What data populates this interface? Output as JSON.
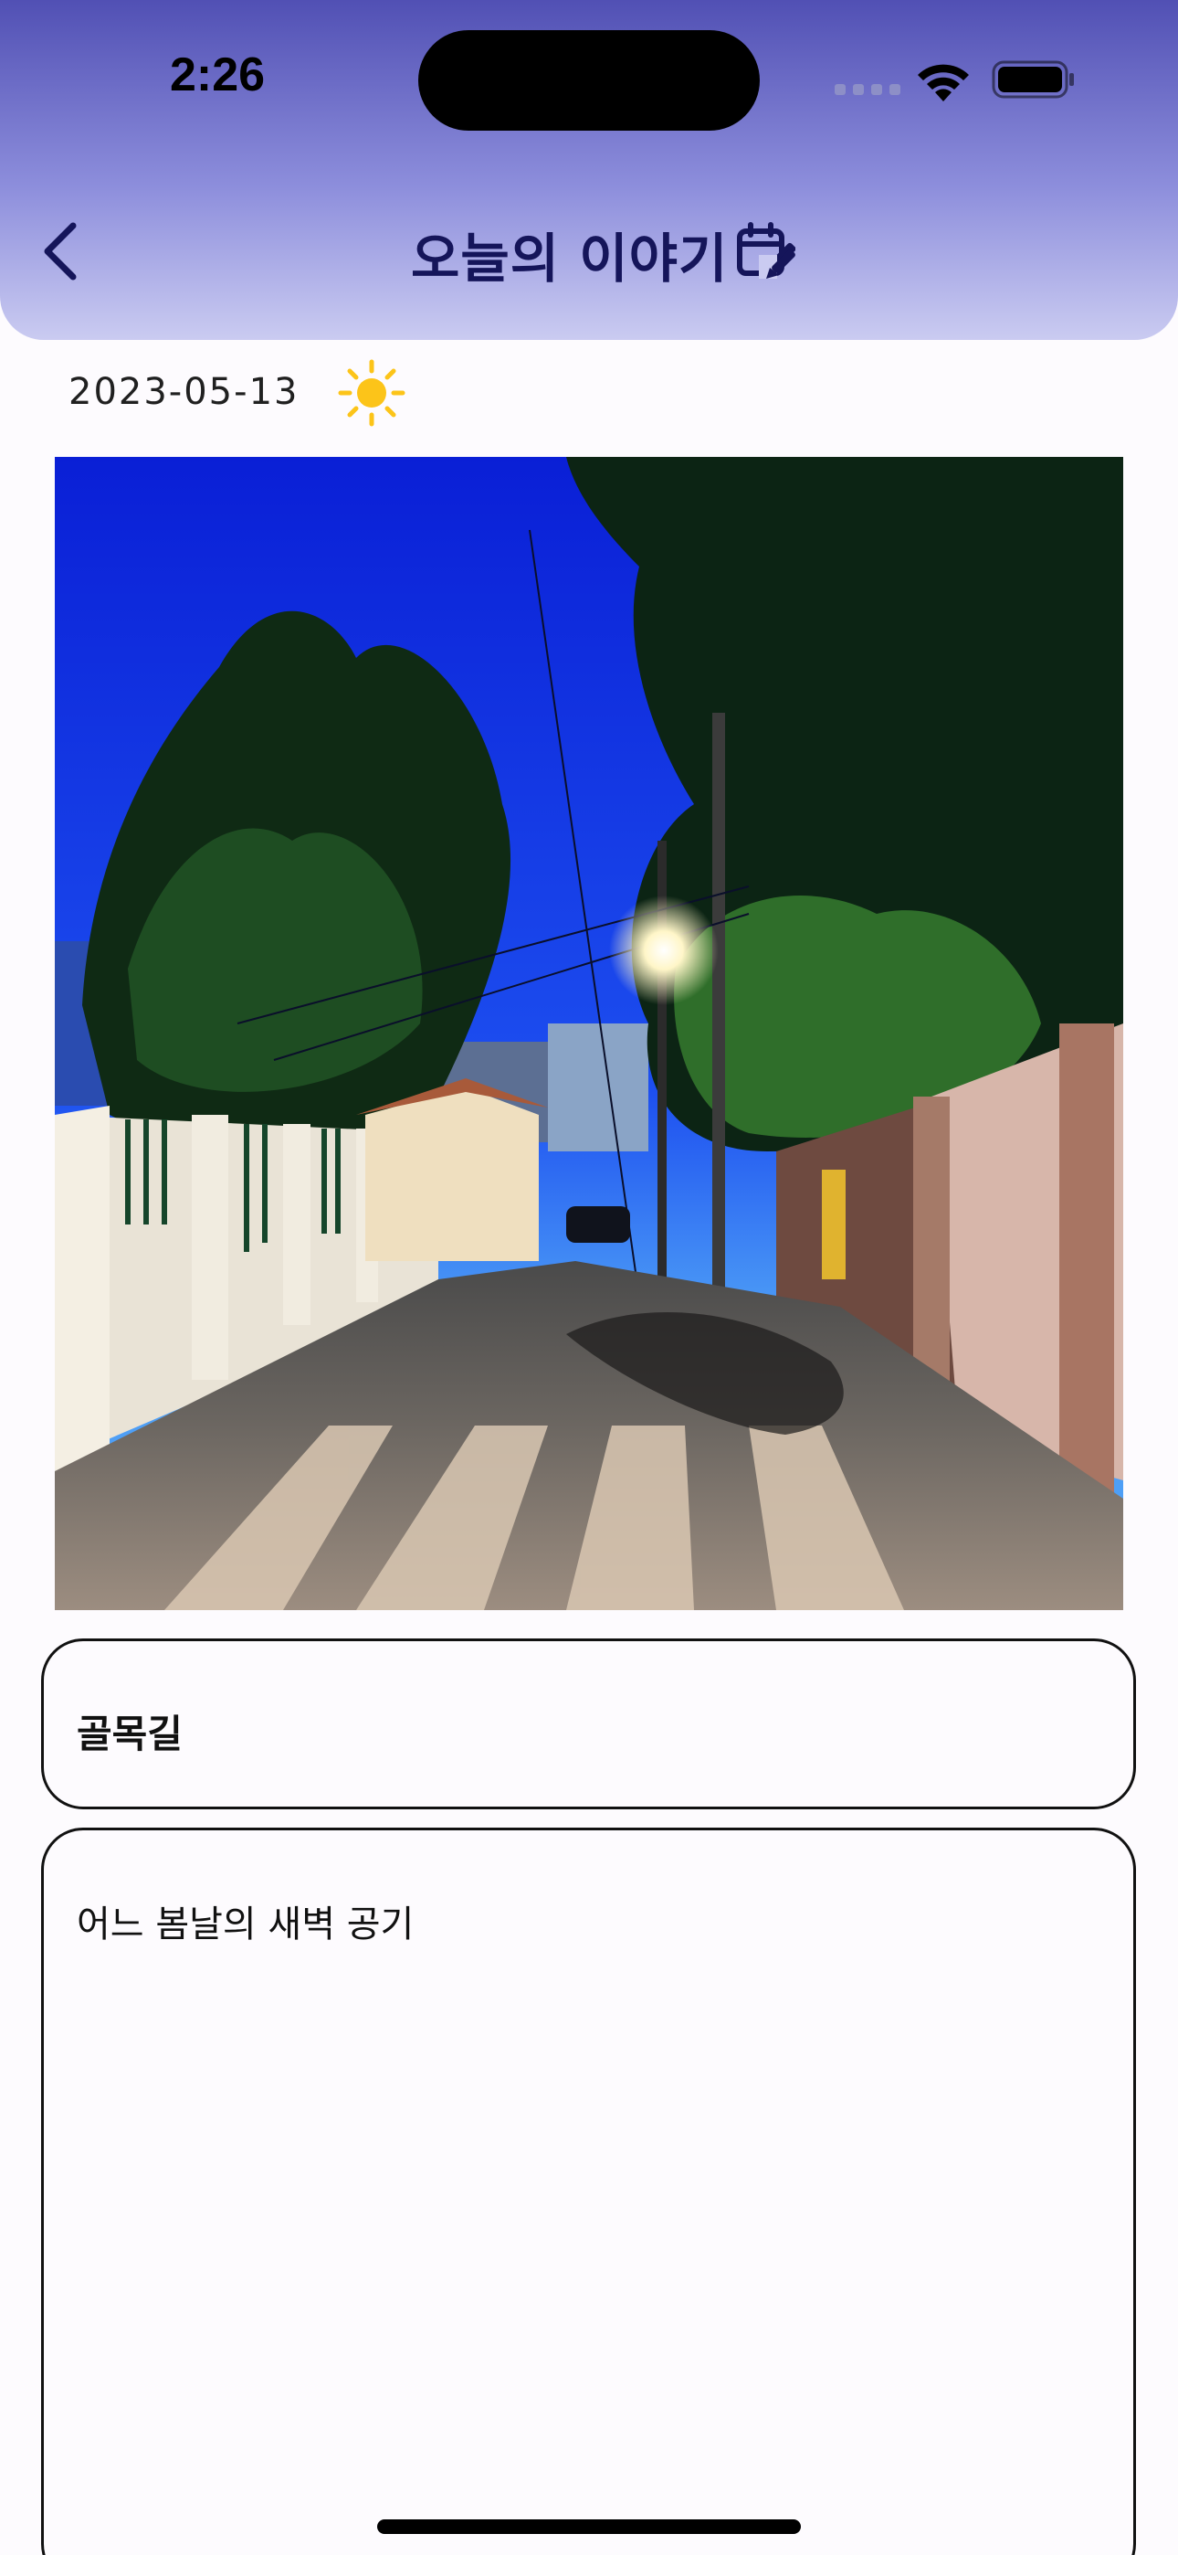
{
  "status_bar": {
    "time": "2:26",
    "icons": [
      "cellular-icon",
      "wifi-icon",
      "battery-icon"
    ]
  },
  "header": {
    "title": "오늘의 이야기",
    "back_icon": "chevron-left-icon",
    "action_icon": "calendar-edit-icon"
  },
  "entry": {
    "date": "2023-05-13",
    "weather_icon": "sun-icon",
    "photo": "night-alley-photo",
    "title": "골목길",
    "body": "어느 봄날의 새벽 공기"
  },
  "colors": {
    "header_top": "#5150b4",
    "header_bottom": "#cacbf1",
    "title_color": "#15155a",
    "sun_color": "#fcc419"
  }
}
